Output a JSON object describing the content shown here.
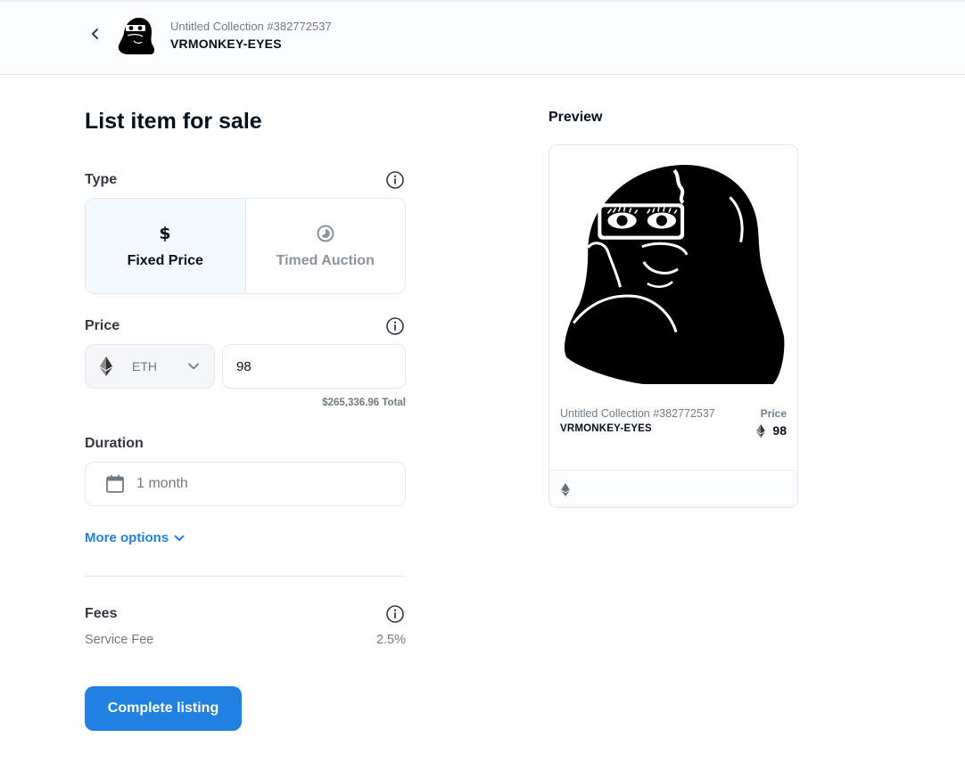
{
  "header": {
    "collection": "Untitled Collection #382772537",
    "item_name": "VRMONKEY-EYES"
  },
  "page": {
    "title": "List item for sale"
  },
  "type": {
    "label": "Type",
    "options": [
      {
        "label": "Fixed Price",
        "icon": "dollar-icon",
        "selected": true
      },
      {
        "label": "Timed Auction",
        "icon": "clock-icon",
        "selected": false
      }
    ]
  },
  "price": {
    "label": "Price",
    "currency": "ETH",
    "value": "98",
    "total": "$265,336.96 Total"
  },
  "duration": {
    "label": "Duration",
    "value": "1 month"
  },
  "more_options": "More options",
  "fees": {
    "label": "Fees",
    "service_fee_label": "Service Fee",
    "service_fee_value": "2.5%"
  },
  "complete_button": "Complete listing",
  "preview": {
    "label": "Preview",
    "collection": "Untitled Collection #382772537",
    "item_name": "VRMONKEY-EYES",
    "price_label": "Price",
    "price_value": "98"
  },
  "colors": {
    "accent": "#2081e2",
    "text": "#04111d",
    "muted": "#707a83",
    "border": "#e5e8eb",
    "selected_bg": "#f3f9fe"
  }
}
